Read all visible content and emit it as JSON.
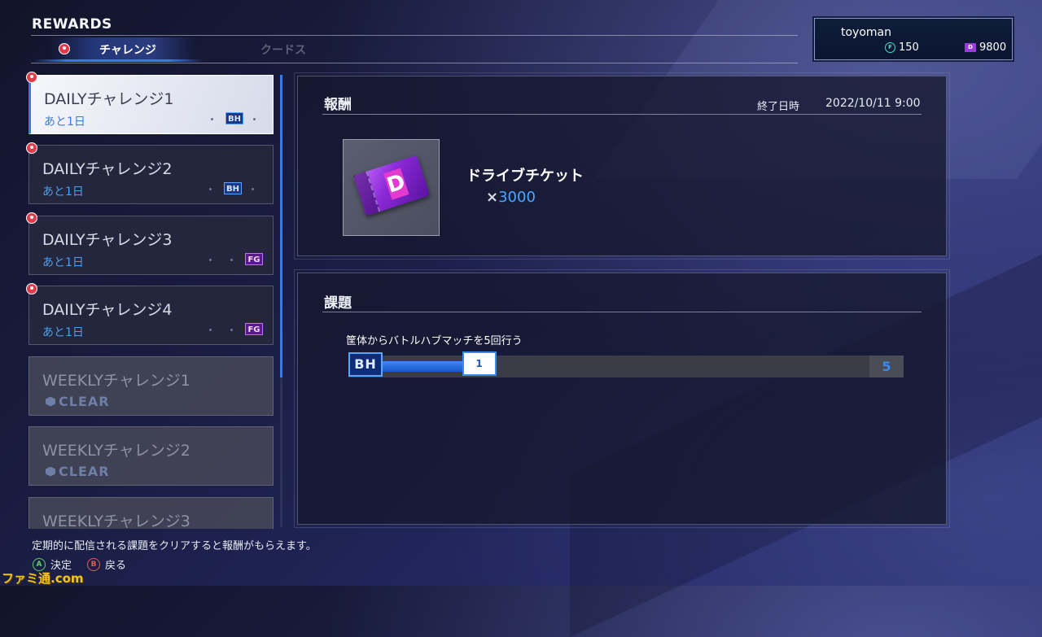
{
  "header": {
    "title": "REWARDS",
    "tabs": [
      {
        "label": "チャレンジ",
        "active": true,
        "badge": true
      },
      {
        "label": "クードス",
        "active": false,
        "badge": false
      }
    ]
  },
  "user": {
    "name": "toyoman",
    "f_points": "150",
    "f_icon": "f-coin-icon",
    "d_tickets": "9800",
    "d_icon": "drive-ticket-icon",
    "f_color": "#3de0c8",
    "d_color": "#9a3ad8"
  },
  "challenges": [
    {
      "name": "DAILYチャレンジ1",
      "sub": "あと1日",
      "tag": "BH",
      "badge": true,
      "selected": true,
      "cleared": false
    },
    {
      "name": "DAILYチャレンジ2",
      "sub": "あと1日",
      "tag": "BH",
      "badge": true,
      "selected": false,
      "cleared": false
    },
    {
      "name": "DAILYチャレンジ3",
      "sub": "あと1日",
      "tag": "FG",
      "badge": true,
      "selected": false,
      "cleared": false
    },
    {
      "name": "DAILYチャレンジ4",
      "sub": "あと1日",
      "tag": "FG",
      "badge": true,
      "selected": false,
      "cleared": false
    },
    {
      "name": "WEEKLYチャレンジ1",
      "sub": "CLEAR",
      "tag": "",
      "badge": false,
      "selected": false,
      "cleared": true
    },
    {
      "name": "WEEKLYチャレンジ2",
      "sub": "CLEAR",
      "tag": "",
      "badge": false,
      "selected": false,
      "cleared": true
    },
    {
      "name": "WEEKLYチャレンジ3",
      "sub": "",
      "tag": "",
      "badge": false,
      "selected": false,
      "cleared": false
    }
  ],
  "reward": {
    "title": "報酬",
    "end_label": "終了日時",
    "end_date": "2022/10/11 9:00",
    "item_name": "ドライブチケット",
    "qty_prefix": "×",
    "qty": "3000",
    "item_icon": "drive-ticket-icon"
  },
  "task": {
    "title": "課題",
    "description": "筐体からバトルハブマッチを5回行う",
    "mode_tag": "BH",
    "current": 1,
    "goal": 5,
    "current_label": "1",
    "goal_label": "5"
  },
  "footer": {
    "help": "定期的に配信される課題をクリアすると報酬がもらえます。",
    "confirm_key": "A",
    "confirm_label": "決定",
    "back_key": "B",
    "back_label": "戻る",
    "watermark": "ファミ通.com"
  },
  "colors": {
    "accent": "#3a7ae8",
    "badge": "#e23b4a",
    "bh_tag": "#173a88",
    "fg_tag": "#5a1a8a"
  }
}
